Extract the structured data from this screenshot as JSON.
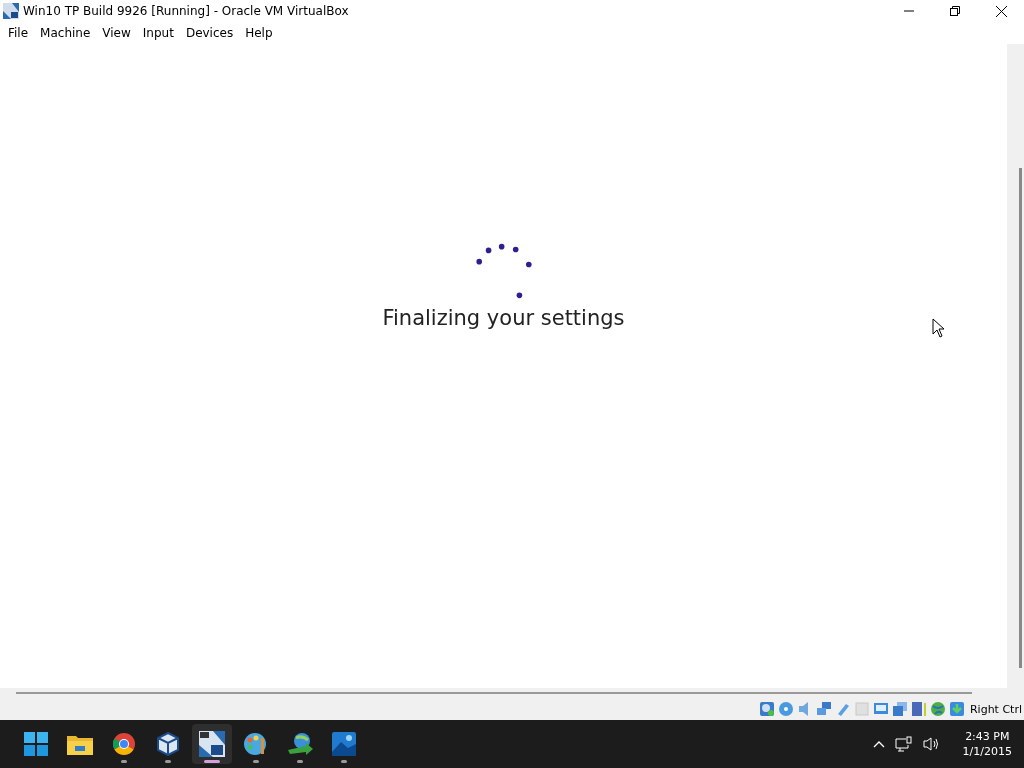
{
  "window": {
    "title": "Win10 TP Build 9926 [Running] - Oracle VM VirtualBox"
  },
  "menu": [
    "File",
    "Machine",
    "View",
    "Input",
    "Devices",
    "Help"
  ],
  "guest": {
    "message": "Finalizing your settings"
  },
  "status_bar": {
    "host_key": "Right Ctrl"
  },
  "taskbar": {
    "apps": [
      {
        "kind": "start",
        "running": false,
        "selected": false
      },
      {
        "kind": "folder",
        "running": false,
        "selected": false
      },
      {
        "kind": "browser",
        "running": true,
        "selected": false
      },
      {
        "kind": "cube",
        "running": true,
        "selected": false
      },
      {
        "kind": "vm",
        "running": true,
        "selected": true
      },
      {
        "kind": "paint",
        "running": true,
        "selected": false
      },
      {
        "kind": "globe",
        "running": true,
        "selected": false
      },
      {
        "kind": "photos",
        "running": true,
        "selected": false
      }
    ],
    "time": "2:43 PM",
    "date": "1/1/2015"
  }
}
